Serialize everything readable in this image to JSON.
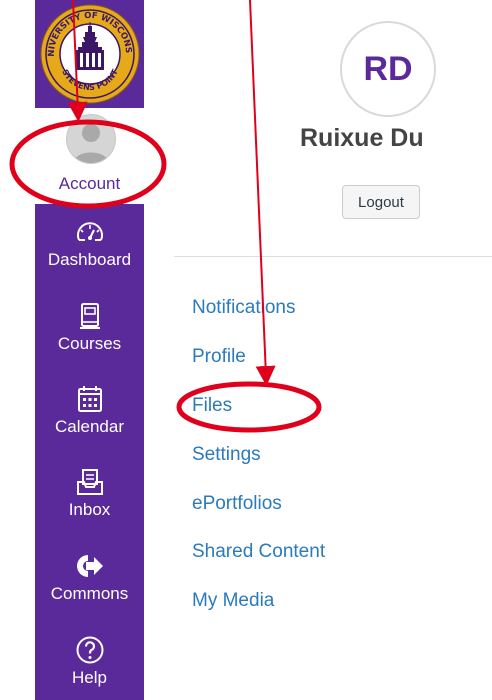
{
  "sidebar": {
    "logo": {
      "top_text": "UNIVERSITY OF WISCONSIN",
      "bottom_text": "STEVENS POINT"
    },
    "account_label": "Account",
    "items": [
      {
        "label": "Dashboard",
        "icon": "dashboard-gauge-icon"
      },
      {
        "label": "Courses",
        "icon": "courses-book-icon"
      },
      {
        "label": "Calendar",
        "icon": "calendar-icon"
      },
      {
        "label": "Inbox",
        "icon": "inbox-icon"
      },
      {
        "label": "Commons",
        "icon": "commons-arrow-icon"
      },
      {
        "label": "Help",
        "icon": "help-question-icon"
      }
    ]
  },
  "profile": {
    "initials": "RD",
    "name": "Ruixue Du",
    "logout_label": "Logout"
  },
  "menu": [
    {
      "label": "Notifications"
    },
    {
      "label": "Profile"
    },
    {
      "label": "Files"
    },
    {
      "label": "Settings"
    },
    {
      "label": "ePortfolios"
    },
    {
      "label": "Shared Content"
    },
    {
      "label": "My Media"
    }
  ],
  "colors": {
    "sidebar_bg": "#5b2a9a",
    "link": "#2b7abc",
    "annotation": "#e0001b",
    "logo_gold": "#e6a91a"
  }
}
